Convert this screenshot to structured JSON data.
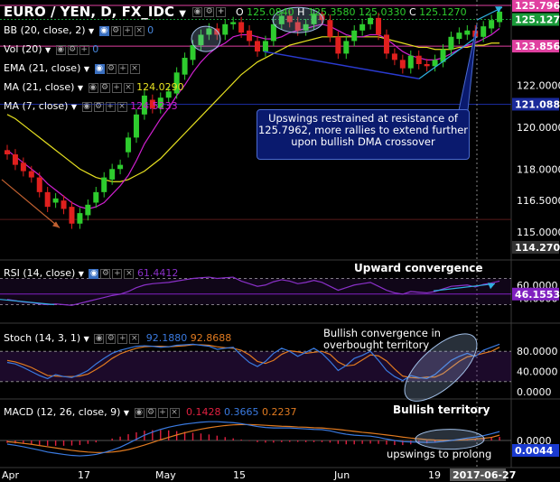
{
  "header": {
    "symbol": "EURO / YEN, D, FX_IDC",
    "o_label": "O",
    "o": "125.0840",
    "h_label": "H",
    "h": "125.3580",
    "c_label": "C",
    "c": "125.1270",
    "extra": "125.0330",
    "dropdown_icon": "chevron-down-icon"
  },
  "indicators": {
    "bb": "BB (20, close, 2)",
    "bb_value": "0",
    "vol": "Vol (20)",
    "vol_value": "0",
    "ema": "EMA (21, close)",
    "ma21": "MA (21, close)",
    "ma21_value": "124.0290",
    "ma7": "MA (7, close)",
    "ma7_value": "124.5233",
    "rsi": "RSI (14, close)",
    "rsi_value": "61.4412",
    "stoch": "Stoch (14, 3, 1)",
    "stoch_k": "92.1880",
    "stoch_d": "92.8688",
    "macd": "MACD (12, 26, close, 9)",
    "macd_hist": "0.1428",
    "macd_line": "0.3665",
    "macd_signal": "0.2237"
  },
  "price_axis": {
    "ticks": [
      "122.0000",
      "120.0000",
      "118.0000",
      "116.5000",
      "115.0000"
    ],
    "tags": [
      {
        "value": "125.7962",
        "bg": "#e040a0",
        "fg": "#ffffff"
      },
      {
        "value": "125.1270",
        "bg": "#1a9a3a",
        "fg": "#ffffff"
      },
      {
        "value": "123.8561",
        "bg": "#e040a0",
        "fg": "#ffffff"
      },
      {
        "value": "121.0887",
        "bg": "#1a2a9a",
        "fg": "#ffffff"
      },
      {
        "value": "114.2705",
        "bg": "#333333",
        "fg": "#ffffff"
      }
    ]
  },
  "rsi_axis": {
    "ticks": [
      "60.0000",
      "40.0000"
    ],
    "tag": "46.1553",
    "tag_bg": "#8020c0"
  },
  "stoch_axis": {
    "ticks": [
      "80.0000",
      "40.0000",
      "0.0000"
    ]
  },
  "macd_axis": {
    "ticks": [
      "0.0000"
    ],
    "tag": "0.0044",
    "tag_bg": "#1a3ad0"
  },
  "x_axis": {
    "labels": [
      "Apr",
      "17",
      "May",
      "15",
      "Jun",
      "19"
    ],
    "date_tag": "2017-06-27"
  },
  "annotations": {
    "callout": "Upswings restrained at resistance of 125.7962, more rallies to extend further upon bullish DMA crossover",
    "rsi_note": "Upward convergence",
    "stoch_note_1": "Bullish convergence in",
    "stoch_note_2": "overbought territory",
    "macd_note_1": "Bullish territory",
    "macd_note_2": "upswings to prolong"
  },
  "colors": {
    "bull": "#2ecc2e",
    "bear": "#e0201e",
    "ma7": "#d020d0",
    "ma21": "#e6e020",
    "rsi": "#8a30c8",
    "stoch_k": "#3a7ae0",
    "stoch_d": "#e07a20",
    "macd": "#3a7ae0",
    "signal": "#e07a20",
    "hist": "#e02040"
  },
  "chart_data": {
    "type": "candlestick",
    "title": "EURO / YEN, D, FX_IDC",
    "ylim": [
      114.2705,
      125.7962
    ],
    "candles": [
      [
        118.9,
        118.7
      ],
      [
        118.7,
        118.2
      ],
      [
        118.3,
        117.9
      ],
      [
        117.9,
        117.6
      ],
      [
        117.6,
        116.9
      ],
      [
        116.9,
        116.2
      ],
      [
        116.4,
        116.6
      ],
      [
        116.5,
        116.1
      ],
      [
        116.2,
        115.4
      ],
      [
        115.4,
        115.9
      ],
      [
        115.8,
        116.3
      ],
      [
        116.4,
        116.9
      ],
      [
        116.9,
        117.6
      ],
      [
        117.5,
        118.0
      ],
      [
        118.0,
        118.2
      ],
      [
        118.8,
        119.5
      ],
      [
        119.5,
        120.6
      ],
      [
        120.6,
        121.5
      ],
      [
        121.3,
        120.9
      ],
      [
        120.9,
        121.4
      ],
      [
        121.4,
        121.7
      ],
      [
        121.6,
        122.6
      ],
      [
        122.5,
        123.3
      ],
      [
        123.2,
        123.9
      ],
      [
        123.9,
        124.4
      ],
      [
        124.4,
        124.7
      ],
      [
        124.7,
        124.4
      ],
      [
        124.4,
        124.9
      ],
      [
        124.9,
        125.0
      ],
      [
        125.0,
        124.5
      ],
      [
        124.6,
        124.1
      ],
      [
        124.1,
        123.6
      ],
      [
        123.6,
        124.1
      ],
      [
        124.1,
        124.9
      ],
      [
        124.9,
        125.3
      ],
      [
        125.3,
        125.0
      ],
      [
        125.0,
        124.6
      ],
      [
        124.6,
        124.9
      ],
      [
        124.9,
        125.4
      ],
      [
        125.4,
        125.1
      ],
      [
        125.1,
        124.3
      ],
      [
        124.3,
        123.5
      ],
      [
        123.5,
        124.1
      ],
      [
        124.1,
        124.6
      ],
      [
        124.6,
        124.9
      ],
      [
        124.9,
        125.2
      ],
      [
        125.2,
        124.4
      ],
      [
        124.4,
        123.5
      ],
      [
        123.5,
        123.2
      ],
      [
        123.2,
        122.8
      ],
      [
        122.8,
        123.4
      ],
      [
        123.4,
        123.0
      ],
      [
        123.0,
        122.9
      ],
      [
        122.9,
        123.2
      ],
      [
        123.1,
        123.7
      ],
      [
        123.7,
        124.3
      ],
      [
        124.2,
        124.5
      ],
      [
        124.4,
        124.6
      ],
      [
        124.6,
        124.3
      ],
      [
        124.3,
        124.8
      ],
      [
        124.7,
        125.1
      ],
      [
        125.0,
        125.5
      ]
    ],
    "ma7": [
      118.9,
      118.6,
      118.3,
      118.0,
      117.7,
      117.3,
      117.0,
      116.7,
      116.4,
      116.2,
      116.1,
      116.2,
      116.4,
      116.8,
      117.2,
      117.7,
      118.4,
      119.2,
      119.8,
      120.4,
      120.9,
      121.5,
      122.0,
      122.6,
      123.1,
      123.5,
      123.8,
      124.0,
      124.3,
      124.4,
      124.4,
      124.3,
      124.2,
      124.2,
      124.3,
      124.5,
      124.6,
      124.7,
      124.8,
      124.9,
      124.8,
      124.6,
      124.4,
      124.3,
      124.3,
      124.4,
      124.4,
      124.2,
      123.9,
      123.6,
      123.4,
      123.3,
      123.2,
      123.2,
      123.3,
      123.5,
      123.7,
      123.9,
      124.0,
      124.2,
      124.4,
      124.7
    ],
    "ma21": [
      120.6,
      120.4,
      120.1,
      119.8,
      119.5,
      119.2,
      118.9,
      118.6,
      118.3,
      118.0,
      117.8,
      117.6,
      117.5,
      117.4,
      117.4,
      117.5,
      117.7,
      117.9,
      118.2,
      118.5,
      118.9,
      119.3,
      119.7,
      120.1,
      120.5,
      120.9,
      121.3,
      121.7,
      122.1,
      122.5,
      122.8,
      123.1,
      123.3,
      123.5,
      123.7,
      123.9,
      124.0,
      124.1,
      124.2,
      124.3,
      124.3,
      124.3,
      124.3,
      124.3,
      124.3,
      124.3,
      124.3,
      124.2,
      124.1,
      124.0,
      123.9,
      123.8,
      123.8,
      123.7,
      123.7,
      123.7,
      123.8,
      123.8,
      123.9,
      123.9,
      124.0,
      124.0
    ],
    "rsi": {
      "ylim": [
        20,
        80
      ],
      "values": [
        38,
        36,
        34,
        33,
        31,
        30,
        31,
        30,
        29,
        32,
        35,
        38,
        41,
        44,
        46,
        50,
        56,
        60,
        62,
        63,
        64,
        66,
        68,
        70,
        71,
        72,
        70,
        71,
        72,
        66,
        62,
        58,
        60,
        65,
        68,
        66,
        62,
        64,
        67,
        64,
        58,
        52,
        56,
        60,
        62,
        64,
        58,
        52,
        48,
        46,
        50,
        49,
        48,
        50,
        54,
        58,
        59,
        60,
        57,
        61,
        63,
        66
      ],
      "levels": [
        70,
        30
      ]
    },
    "stoch": {
      "ylim": [
        0,
        100
      ],
      "k": [
        58,
        55,
        48,
        40,
        32,
        26,
        34,
        30,
        28,
        34,
        42,
        55,
        66,
        76,
        82,
        86,
        90,
        91,
        90,
        88,
        89,
        92,
        93,
        94,
        92,
        90,
        84,
        86,
        88,
        72,
        58,
        50,
        60,
        76,
        86,
        80,
        70,
        78,
        86,
        76,
        60,
        42,
        52,
        66,
        72,
        80,
        62,
        42,
        30,
        22,
        32,
        28,
        26,
        34,
        48,
        62,
        70,
        76,
        70,
        82,
        88,
        94
      ],
      "d": [
        62,
        59,
        54,
        48,
        40,
        32,
        31,
        30,
        30,
        31,
        35,
        44,
        54,
        66,
        75,
        81,
        86,
        89,
        90,
        90,
        89,
        90,
        91,
        93,
        93,
        92,
        89,
        87,
        86,
        82,
        73,
        60,
        56,
        62,
        74,
        81,
        79,
        76,
        78,
        80,
        74,
        59,
        51,
        53,
        63,
        73,
        71,
        61,
        45,
        31,
        28,
        27,
        29,
        29,
        36,
        48,
        60,
        69,
        72,
        76,
        80,
        88
      ]
    },
    "macd": {
      "ylim": [
        -0.9,
        0.9
      ],
      "line": [
        -0.15,
        -0.2,
        -0.26,
        -0.33,
        -0.4,
        -0.48,
        -0.53,
        -0.58,
        -0.62,
        -0.64,
        -0.62,
        -0.58,
        -0.5,
        -0.4,
        -0.28,
        -0.12,
        0.05,
        0.22,
        0.35,
        0.46,
        0.55,
        0.62,
        0.68,
        0.72,
        0.76,
        0.78,
        0.78,
        0.76,
        0.74,
        0.7,
        0.64,
        0.58,
        0.54,
        0.52,
        0.52,
        0.52,
        0.5,
        0.48,
        0.46,
        0.45,
        0.4,
        0.32,
        0.26,
        0.22,
        0.2,
        0.18,
        0.13,
        0.06,
        0.0,
        -0.05,
        -0.06,
        -0.07,
        -0.08,
        -0.07,
        -0.04,
        0.0,
        0.05,
        0.1,
        0.14,
        0.2,
        0.28,
        0.37
      ],
      "signal": [
        -0.05,
        -0.08,
        -0.12,
        -0.16,
        -0.21,
        -0.26,
        -0.31,
        -0.36,
        -0.41,
        -0.45,
        -0.48,
        -0.5,
        -0.5,
        -0.48,
        -0.44,
        -0.38,
        -0.29,
        -0.19,
        -0.08,
        0.03,
        0.13,
        0.23,
        0.32,
        0.4,
        0.47,
        0.53,
        0.58,
        0.62,
        0.65,
        0.66,
        0.66,
        0.65,
        0.63,
        0.61,
        0.59,
        0.58,
        0.56,
        0.55,
        0.53,
        0.52,
        0.49,
        0.46,
        0.42,
        0.38,
        0.34,
        0.31,
        0.27,
        0.23,
        0.19,
        0.14,
        0.1,
        0.07,
        0.04,
        0.02,
        0.01,
        0.01,
        0.02,
        0.04,
        0.06,
        0.09,
        0.13,
        0.22
      ]
    }
  }
}
